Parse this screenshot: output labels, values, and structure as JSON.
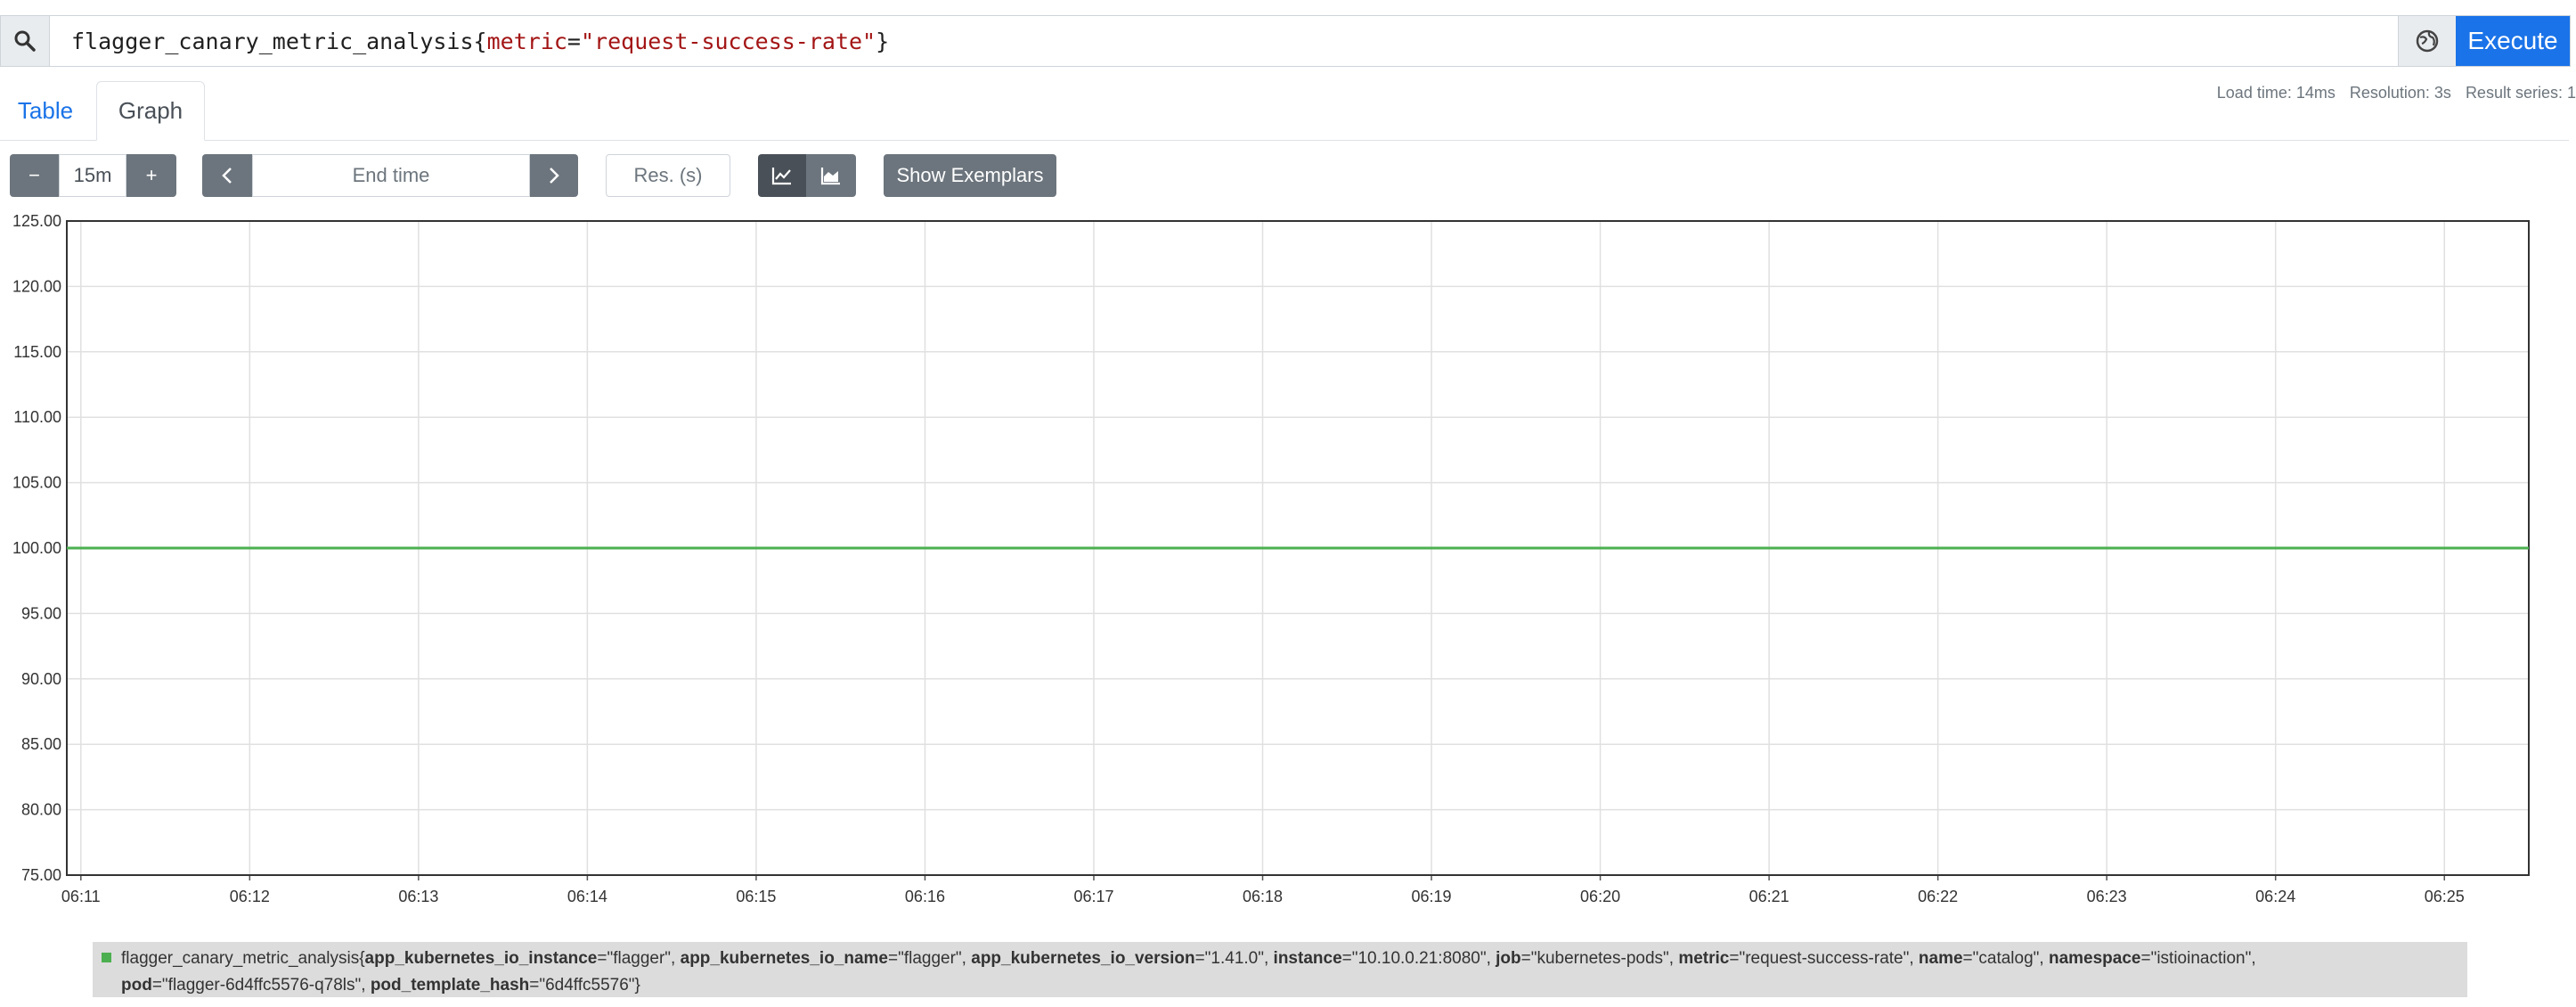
{
  "query": {
    "metric_name": "flagger_canary_metric_analysis",
    "label_key": "metric",
    "label_value": "\"request-success-rate\"",
    "execute_label": "Execute"
  },
  "tabs": {
    "table": "Table",
    "graph": "Graph"
  },
  "stats": {
    "load_time": "Load time: 14ms",
    "resolution": "Resolution: 3s",
    "result_series": "Result series: 1"
  },
  "controls": {
    "range_minus": "−",
    "range_value": "15m",
    "range_plus": "+",
    "time_prev": "‹",
    "end_time_placeholder": "End time",
    "time_next": "›",
    "resolution_placeholder": "Res. (s)",
    "show_exemplars": "Show Exemplars"
  },
  "icons": {
    "search": "search-icon",
    "globe": "globe-icon",
    "line_chart": "line-chart-icon",
    "stacked_chart": "stacked-chart-icon"
  },
  "colors": {
    "accent": "#1a73e8",
    "series": "#4caf50"
  },
  "chart_data": {
    "type": "line",
    "ylim": [
      75,
      125
    ],
    "yticks": [
      "75.00",
      "80.00",
      "85.00",
      "90.00",
      "95.00",
      "100.00",
      "105.00",
      "110.00",
      "115.00",
      "120.00",
      "125.00"
    ],
    "xticks": [
      "06:11",
      "06:12",
      "06:13",
      "06:14",
      "06:15",
      "06:16",
      "06:17",
      "06:18",
      "06:19",
      "06:20",
      "06:21",
      "06:22",
      "06:23",
      "06:24",
      "06:25"
    ],
    "x_start": "06:10:55",
    "x_end": "06:25:30",
    "series": [
      {
        "name": "flagger_canary_metric_analysis",
        "x": [
          "06:10:55",
          "06:25:30"
        ],
        "values": [
          100,
          100
        ]
      }
    ]
  },
  "legend": {
    "metric": "flagger_canary_metric_analysis",
    "labels": [
      {
        "key": "app_kubernetes_io_instance",
        "value": "\"flagger\""
      },
      {
        "key": "app_kubernetes_io_name",
        "value": "\"flagger\""
      },
      {
        "key": "app_kubernetes_io_version",
        "value": "\"1.41.0\""
      },
      {
        "key": "instance",
        "value": "\"10.10.0.21:8080\""
      },
      {
        "key": "job",
        "value": "\"kubernetes-pods\""
      },
      {
        "key": "metric",
        "value": "\"request-success-rate\""
      },
      {
        "key": "name",
        "value": "\"catalog\""
      },
      {
        "key": "namespace",
        "value": "\"istioinaction\""
      },
      {
        "key": "pod",
        "value": "\"flagger-6d4ffc5576-q78ls\""
      },
      {
        "key": "pod_template_hash",
        "value": "\"6d4ffc5576\""
      }
    ]
  }
}
